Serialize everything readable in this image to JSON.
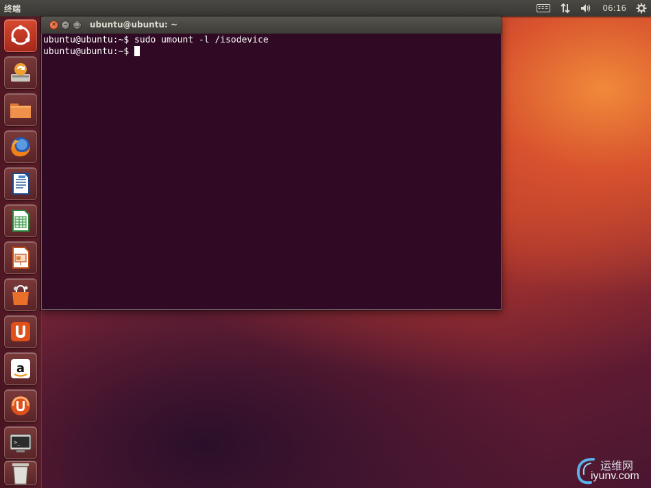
{
  "top_panel": {
    "app_title": "终端",
    "clock": "06:16",
    "icons": [
      "keyboard-icon",
      "network-arrows-icon",
      "volume-icon",
      "gear-icon"
    ]
  },
  "launcher": {
    "items": [
      "dash-home-icon",
      "software-updater-icon",
      "files-icon",
      "firefox-icon",
      "writer-icon",
      "calc-icon",
      "impress-icon",
      "software-center-icon",
      "ubuntu-one-icon",
      "amazon-icon",
      "ubuntu-one-music-icon",
      "terminal-icon",
      "trash-icon"
    ]
  },
  "terminal": {
    "title": "ubuntu@ubuntu: ~",
    "lines": [
      "ubuntu@ubuntu:~$ sudo umount -l /isodevice",
      "ubuntu@ubuntu:~$ "
    ]
  },
  "watermark": {
    "cn": "运维网",
    "en": "iyunv.com"
  },
  "colors": {
    "terminal_bg": "#300a24",
    "panel_bg": "#3c3b37",
    "close_button": "#e0522d"
  }
}
